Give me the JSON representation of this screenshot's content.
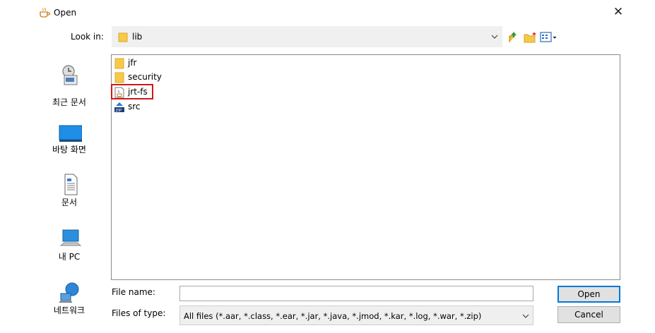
{
  "window": {
    "title": "Open",
    "close_glyph": "✕",
    "icon": "java-cup-icon"
  },
  "look_in": {
    "label": "Look in:",
    "value": "lib"
  },
  "toolbar": [
    {
      "name": "up-one-level-icon"
    },
    {
      "name": "new-folder-icon"
    },
    {
      "name": "view-menu-icon"
    }
  ],
  "places": [
    {
      "label": "최근 문서",
      "icon": "recent-items-icon"
    },
    {
      "label": "바탕 화면",
      "icon": "desktop-icon"
    },
    {
      "label": "문서",
      "icon": "documents-icon"
    },
    {
      "label": "내 PC",
      "icon": "this-pc-icon"
    },
    {
      "label": "네트워크",
      "icon": "network-icon"
    }
  ],
  "files": [
    {
      "name": "jfr",
      "icon": "folder-icon"
    },
    {
      "name": "security",
      "icon": "folder-icon"
    },
    {
      "name": "jrt-fs",
      "icon": "java-file-icon",
      "highlighted": true
    },
    {
      "name": "src",
      "icon": "zip-file-icon"
    }
  ],
  "file_name": {
    "label": "File name:",
    "value": ""
  },
  "file_type": {
    "label": "Files of type:",
    "value": "All files (*.aar, *.class, *.ear, *.jar, *.java, *.jmod, *.kar, *.log, *.war, *.zip)"
  },
  "buttons": {
    "open": "Open",
    "cancel": "Cancel"
  },
  "colors": {
    "highlight_border": "#d01818",
    "primary_button_border": "#0078d7",
    "folder": "#f7c948"
  }
}
